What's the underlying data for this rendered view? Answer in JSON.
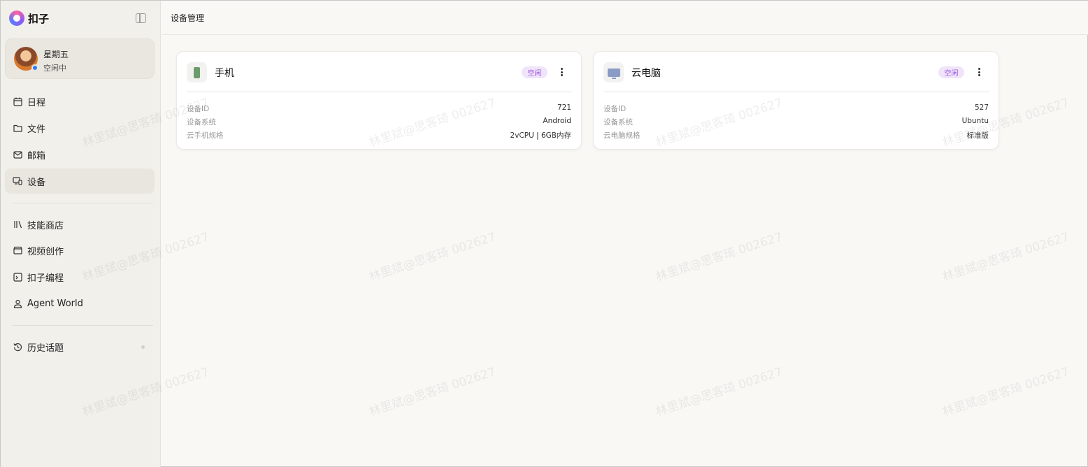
{
  "brand": {
    "name": "扣子"
  },
  "user": {
    "name": "星期五",
    "status": "空闲中"
  },
  "nav": {
    "schedule": "日程",
    "files": "文件",
    "mail": "邮箱",
    "devices": "设备",
    "skill_store": "技能商店",
    "video": "视频创作",
    "coding": "扣子编程",
    "agent_world": "Agent World",
    "history": "历史话题"
  },
  "header": {
    "title": "设备管理"
  },
  "devices": [
    {
      "name": "手机",
      "status": "空闲",
      "fields": [
        {
          "label": "设备ID",
          "value": "721"
        },
        {
          "label": "设备系统",
          "value": "Android"
        },
        {
          "label": "云手机规格",
          "value": "2vCPU | 6GB内存"
        }
      ]
    },
    {
      "name": "云电脑",
      "status": "空闲",
      "fields": [
        {
          "label": "设备ID",
          "value": "527"
        },
        {
          "label": "设备系统",
          "value": "Ubuntu"
        },
        {
          "label": "云电脑规格",
          "value": "标准版"
        }
      ]
    }
  ],
  "watermark": "林里斌@思客琦 002627",
  "colors": {
    "accent": "#9a55d8",
    "badge_bg": "#f0e4fb",
    "status_online": "#2f7df6"
  }
}
